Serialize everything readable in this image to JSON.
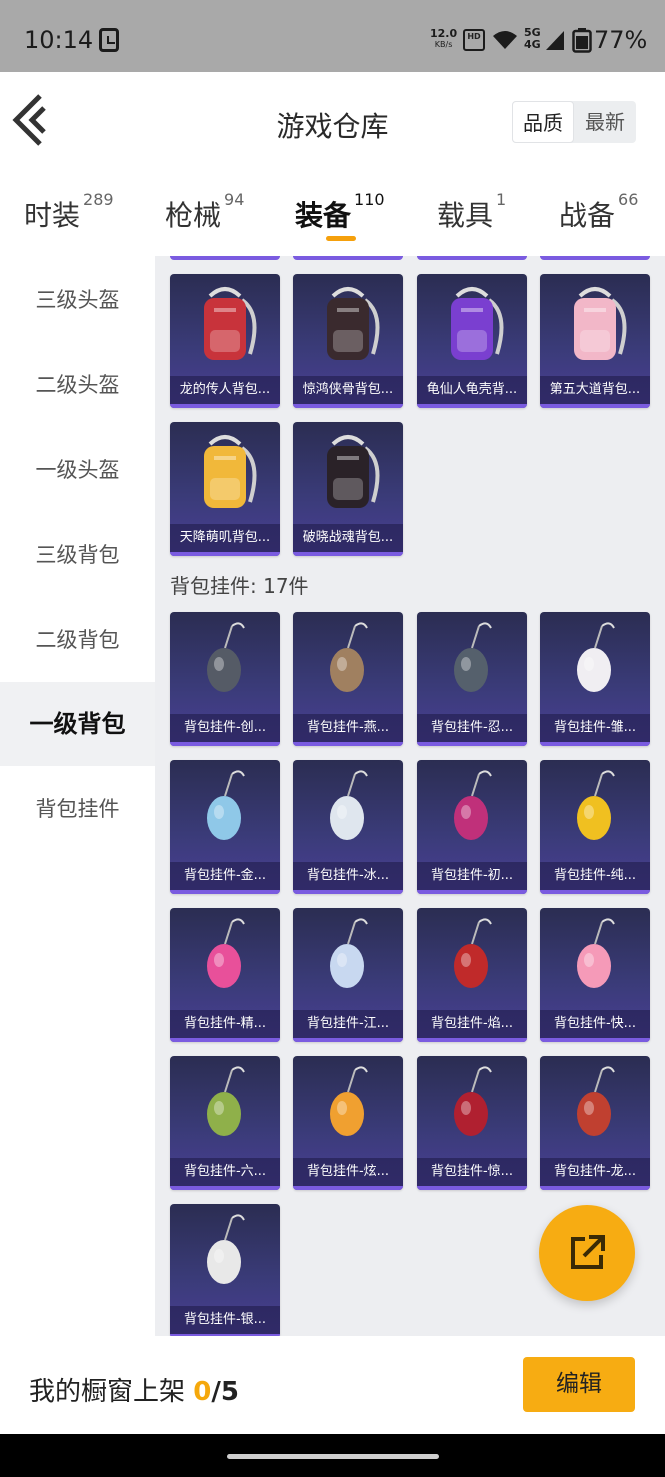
{
  "status_bar": {
    "time": "10:14",
    "speed_value": "12.0",
    "speed_unit": "KB/s",
    "hd": "HD",
    "network": "5G\n4G",
    "battery": "77%"
  },
  "header": {
    "title": "游戏仓库",
    "sort_options": [
      "品质",
      "最新"
    ]
  },
  "tabs": [
    {
      "label": "时装",
      "count": "289"
    },
    {
      "label": "枪械",
      "count": "94"
    },
    {
      "label": "装备",
      "count": "110"
    },
    {
      "label": "载具",
      "count": "1"
    },
    {
      "label": "战备",
      "count": "66"
    }
  ],
  "sidebar": {
    "items": [
      "三级头盔",
      "二级头盔",
      "一级头盔",
      "三级背包",
      "二级背包",
      "一级背包",
      "背包挂件"
    ],
    "active": "一级背包"
  },
  "backpacks": [
    {
      "label": "龙的传人背包...",
      "icon": "red-backpack-icon",
      "color": "#c8333b"
    },
    {
      "label": "惊鸿侠骨背包...",
      "icon": "black-backpack-icon",
      "color": "#3a2a2e"
    },
    {
      "label": "龟仙人龟壳背...",
      "icon": "purple-backpack-icon",
      "color": "#7a3fd0"
    },
    {
      "label": "第五大道背包...",
      "icon": "pink-backpack-icon",
      "color": "#f2b7c8"
    },
    {
      "label": "天降萌叽背包...",
      "icon": "yellow-backpack-icon",
      "color": "#f1b83a"
    },
    {
      "label": "破晓战魂背包...",
      "icon": "dark-red-backpack-icon",
      "color": "#2a2228"
    }
  ],
  "pendant_section": {
    "label": "背包挂件: 17件"
  },
  "pendants": [
    {
      "label": "背包挂件-创...",
      "icon": "cup-pendant-icon",
      "color": "#555b66"
    },
    {
      "label": "背包挂件-燕...",
      "icon": "swallow-pendant-icon",
      "color": "#a08060"
    },
    {
      "label": "背包挂件-忍...",
      "icon": "shuriken-pendant-icon",
      "color": "#55606c"
    },
    {
      "label": "背包挂件-雏...",
      "icon": "bunny-pendant-icon",
      "color": "#f0eef2"
    },
    {
      "label": "背包挂件-金...",
      "icon": "banner-pendant-icon",
      "color": "#8fc8e8"
    },
    {
      "label": "背包挂件-冰...",
      "icon": "robot-pendant-icon",
      "color": "#dfe6ee"
    },
    {
      "label": "背包挂件-初...",
      "icon": "crystal-pendant-icon",
      "color": "#c0307a"
    },
    {
      "label": "背包挂件-纯...",
      "icon": "opener-pendant-icon",
      "color": "#f0c020"
    },
    {
      "label": "背包挂件-精...",
      "icon": "heart-wing-pendant-icon",
      "color": "#e8509a"
    },
    {
      "label": "背包挂件-江...",
      "icon": "snowflake-pendant-icon",
      "color": "#c8d8f0"
    },
    {
      "label": "背包挂件-焰...",
      "icon": "knot-pendant-icon",
      "color": "#c02a2a"
    },
    {
      "label": "背包挂件-快...",
      "icon": "pink-disc-pendant-icon",
      "color": "#f59ab8"
    },
    {
      "label": "背包挂件-六...",
      "icon": "bird-pendant-icon",
      "color": "#8fb04a"
    },
    {
      "label": "背包挂件-炫...",
      "icon": "egg-pendant-icon",
      "color": "#f0a030"
    },
    {
      "label": "背包挂件-惊...",
      "icon": "ring-tassel-pendant-icon",
      "color": "#b02030"
    },
    {
      "label": "背包挂件-龙...",
      "icon": "lion-pendant-icon",
      "color": "#c04030"
    },
    {
      "label": "背包挂件-银...",
      "icon": "capsule-pendant-icon",
      "color": "#e8e8e8"
    }
  ],
  "bottom_bar": {
    "prefix": "我的橱窗上架 ",
    "count": "0",
    "total": "/5",
    "edit_label": "编辑"
  },
  "colors": {
    "accent": "#f7ac12",
    "card_bg": "#3a3b78",
    "card_border": "#7a5be0"
  }
}
